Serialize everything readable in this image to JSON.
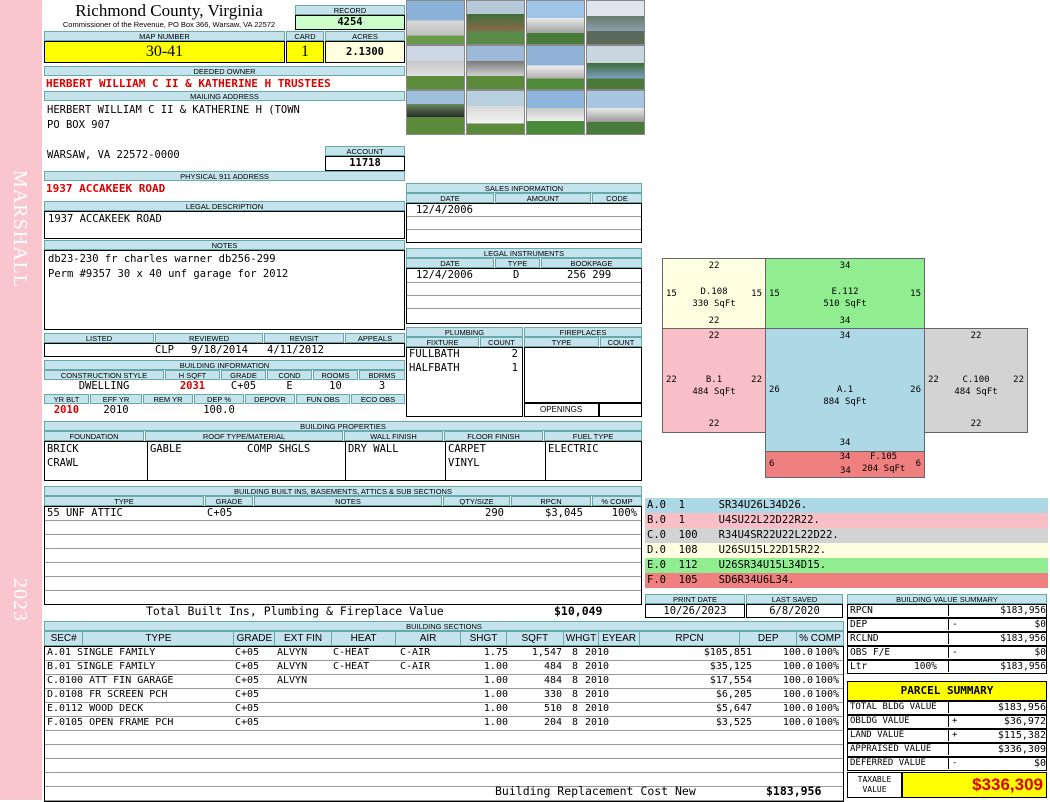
{
  "header": {
    "county": "Richmond County, Virginia",
    "commissioner": "Commissioner of the Revenue, PO Box 366, Warsaw, VA 22572",
    "record_label": "RECORD",
    "record": "4254",
    "map_label": "MAP NUMBER",
    "map": "30-41",
    "card_label": "CARD",
    "card": "1",
    "acres_label": "ACRES",
    "acres": "2.1300"
  },
  "side": {
    "district": "MARSHALL",
    "year": "2023"
  },
  "owner": {
    "label": "DEEDED OWNER",
    "name": "HERBERT WILLIAM C II & KATHERINE H TRUSTEES",
    "mail_label": "MAILING ADDRESS",
    "mail1": "HERBERT WILLIAM C II & KATHERINE H (TOWN",
    "mail2": "PO BOX 907",
    "mail3": "WARSAW, VA 22572-0000",
    "account_label": "ACCOUNT",
    "account": "11718"
  },
  "physical": {
    "label": "PHYSICAL 911 ADDRESS",
    "address": "1937 ACCAKEEK ROAD"
  },
  "legal": {
    "label": "LEGAL DESCRIPTION",
    "text": "1937 ACCAKEEK ROAD"
  },
  "notes": {
    "label": "NOTES",
    "line1": "db23-230 fr charles warner db256-299",
    "line2": "Perm #9357 30 x 40 unf garage for 2012"
  },
  "review": {
    "listed_label": "LISTED",
    "reviewed_label": "REVIEWED",
    "revisit_label": "REVISIT",
    "appeals_label": "APPEALS",
    "listed": "",
    "reviewer": "CLP",
    "reviewed": "9/18/2014",
    "revisit": "4/11/2012",
    "appeals": ""
  },
  "building_info": {
    "label": "BUILDING INFORMATION",
    "h": [
      "CONSTRUCTION STYLE",
      "H SQFT",
      "GRADE",
      "COND",
      "ROOMS",
      "BDRMS"
    ],
    "style": "DWELLING",
    "hsqft": "2031",
    "grade": "C+05",
    "cond": "E",
    "rooms": "10",
    "bdrms": "3",
    "h2": [
      "YR BLT",
      "EFF YR",
      "REM YR",
      "DEP %",
      "DEPOVR",
      "FUN OBS",
      "ECO OBS"
    ],
    "yrblt": "2010",
    "effyr": "2010",
    "remyr": "",
    "dep": "100.0",
    "depovr": "",
    "funobs": "",
    "ecoobs": ""
  },
  "sales": {
    "label": "SALES INFORMATION",
    "h": [
      "DATE",
      "AMOUNT",
      "CODE"
    ],
    "date": "12/4/2006",
    "amount": "",
    "code": ""
  },
  "instruments": {
    "label": "LEGAL INSTRUMENTS",
    "h": [
      "DATE",
      "TYPE",
      "BOOKPAGE"
    ],
    "date": "12/4/2006",
    "type": "D",
    "bookpage": "256 299"
  },
  "plumbing": {
    "label": "PLUMBING",
    "h": [
      "FIXTURE",
      "COUNT"
    ],
    "rows": [
      [
        "FULLBATH",
        "2"
      ],
      [
        "HALFBATH",
        "1"
      ]
    ]
  },
  "fireplaces": {
    "label": "FIREPLACES",
    "h": [
      "TYPE",
      "COUNT"
    ],
    "openings": "OPENINGS"
  },
  "properties": {
    "label": "BUILDING PROPERTIES",
    "h": [
      "FOUNDATION",
      "ROOF TYPE/MATERIAL",
      "WALL FINISH",
      "FLOOR FINISH",
      "FUEL TYPE"
    ],
    "foundation1": "BRICK",
    "foundation2": "CRAWL",
    "roof1": "GABLE",
    "roof2": "COMP SHGLS",
    "wall": "DRY WALL",
    "floor1": "CARPET",
    "floor2": "VINYL",
    "fuel": "ELECTRIC"
  },
  "builtins": {
    "label": "BUILDING BUILT INS, BASEMENTS, ATTICS & SUB SECTIONS",
    "h": [
      "TYPE",
      "GRADE",
      "NOTES",
      "QTY/SIZE",
      "RPCN",
      "% COMP"
    ],
    "type": "55 UNF ATTIC",
    "grade": "C+05",
    "notes": "",
    "qty": "290",
    "rpcn": "$3,045",
    "comp": "100%",
    "total_label": "Total Built Ins, Plumbing & Fireplace Value",
    "total": "$10,049"
  },
  "sketch": {
    "labels": [
      [
        "D.108",
        "330 SqFt",
        "22",
        "15",
        "15",
        "22"
      ],
      [
        "E.112",
        "510 SqFt",
        "34",
        "15",
        "15",
        "34"
      ],
      [
        "B.1",
        "484 SqFt",
        "22",
        "22",
        "22",
        "22"
      ],
      [
        "A.1",
        "884 SqFt",
        "34",
        "26",
        "26",
        "34"
      ],
      [
        "C.100",
        "484 SqFt",
        "22",
        "22",
        "22",
        "22"
      ],
      [
        "F.105",
        "204 SqFt",
        "34",
        "6",
        "6",
        "34"
      ]
    ]
  },
  "segments": [
    [
      "A.0",
      "1",
      "SR34U26L34D26."
    ],
    [
      "B.0",
      "1",
      "U4SU22L22D22R22."
    ],
    [
      "C.0",
      "100",
      "R34U4SR22U22L22D22."
    ],
    [
      "D.0",
      "108",
      "U26SU15L22D15R22."
    ],
    [
      "E.0",
      "112",
      "U26SR34U15L34D15."
    ],
    [
      "F.0",
      "105",
      "SD6R34U6L34."
    ]
  ],
  "print": {
    "print_label": "PRINT DATE",
    "saved_label": "LAST SAVED",
    "print": "10/26/2023",
    "saved": "6/8/2020"
  },
  "sections": {
    "label": "BUILDING SECTIONS",
    "h": [
      "SEC#",
      "TYPE",
      "GRADE",
      "EXT FIN",
      "HEAT",
      "AIR",
      "SHGT",
      "SQFT",
      "WHGT",
      "EYEAR",
      "RPCN",
      "DEP",
      "% COMP"
    ],
    "rows": [
      [
        "A.0",
        "1 SINGLE FAMILY",
        "C+05",
        "ALVYN",
        "C-HEAT",
        "C-AIR",
        "1.75",
        "1,547",
        "8",
        "2010",
        "$105,851",
        "100.0",
        "100%"
      ],
      [
        "B.0",
        "1 SINGLE FAMILY",
        "C+05",
        "ALVYN",
        "C-HEAT",
        "C-AIR",
        "1.00",
        "484",
        "8",
        "2010",
        "$35,125",
        "100.0",
        "100%"
      ],
      [
        "C.0",
        "100 ATT FIN GARAGE",
        "C+05",
        "ALVYN",
        "",
        "",
        "1.00",
        "484",
        "8",
        "2010",
        "$17,554",
        "100.0",
        "100%"
      ],
      [
        "D.0",
        "108 FR SCREEN PCH",
        "C+05",
        "",
        "",
        "",
        "1.00",
        "330",
        "8",
        "2010",
        "$6,205",
        "100.0",
        "100%"
      ],
      [
        "E.0",
        "112 WOOD DECK",
        "C+05",
        "",
        "",
        "",
        "1.00",
        "510",
        "8",
        "2010",
        "$5,647",
        "100.0",
        "100%"
      ],
      [
        "F.0",
        "105 OPEN FRAME PCH",
        "C+05",
        "",
        "",
        "",
        "1.00",
        "204",
        "8",
        "2010",
        "$3,525",
        "100.0",
        "100%"
      ]
    ],
    "rcn_label": "Building Replacement Cost New",
    "rcn": "$183,956"
  },
  "value_summary": {
    "label": "BUILDING VALUE SUMMARY",
    "rpcn_l": "RPCN",
    "rpcn": "$183,956",
    "dep_l": "DEP",
    "dep_s": "-",
    "dep": "$0",
    "rclnd_l": "RCLND",
    "rclnd": "$183,956",
    "obs_l": "OBS F/E",
    "obs_s": "-",
    "obs": "$0",
    "ltr_l": "Ltr",
    "ltr_p": "100%",
    "ltr": "$183,956"
  },
  "parcel": {
    "label": "PARCEL SUMMARY",
    "tb_l": "TOTAL BLDG VALUE",
    "tb": "$183,956",
    "ob_l": "OBLDG VALUE",
    "ob_s": "+",
    "ob": "$36,972",
    "lv_l": "LAND VALUE",
    "lv_s": "+",
    "lv": "$115,382",
    "ap_l": "APPRAISED VALUE",
    "ap": "$336,309",
    "df_l": "DEFERRED VALUE",
    "df_s": "-",
    "df": "$0",
    "tx_l1": "TAXABLE",
    "tx_l2": "VALUE",
    "tx": "$336,309"
  },
  "colors": {
    "pink": "#f9c6cd",
    "header": "#c5e3ec",
    "yellow": "#ffff00",
    "green": "#ccffcc",
    "red": "#dd0000"
  }
}
